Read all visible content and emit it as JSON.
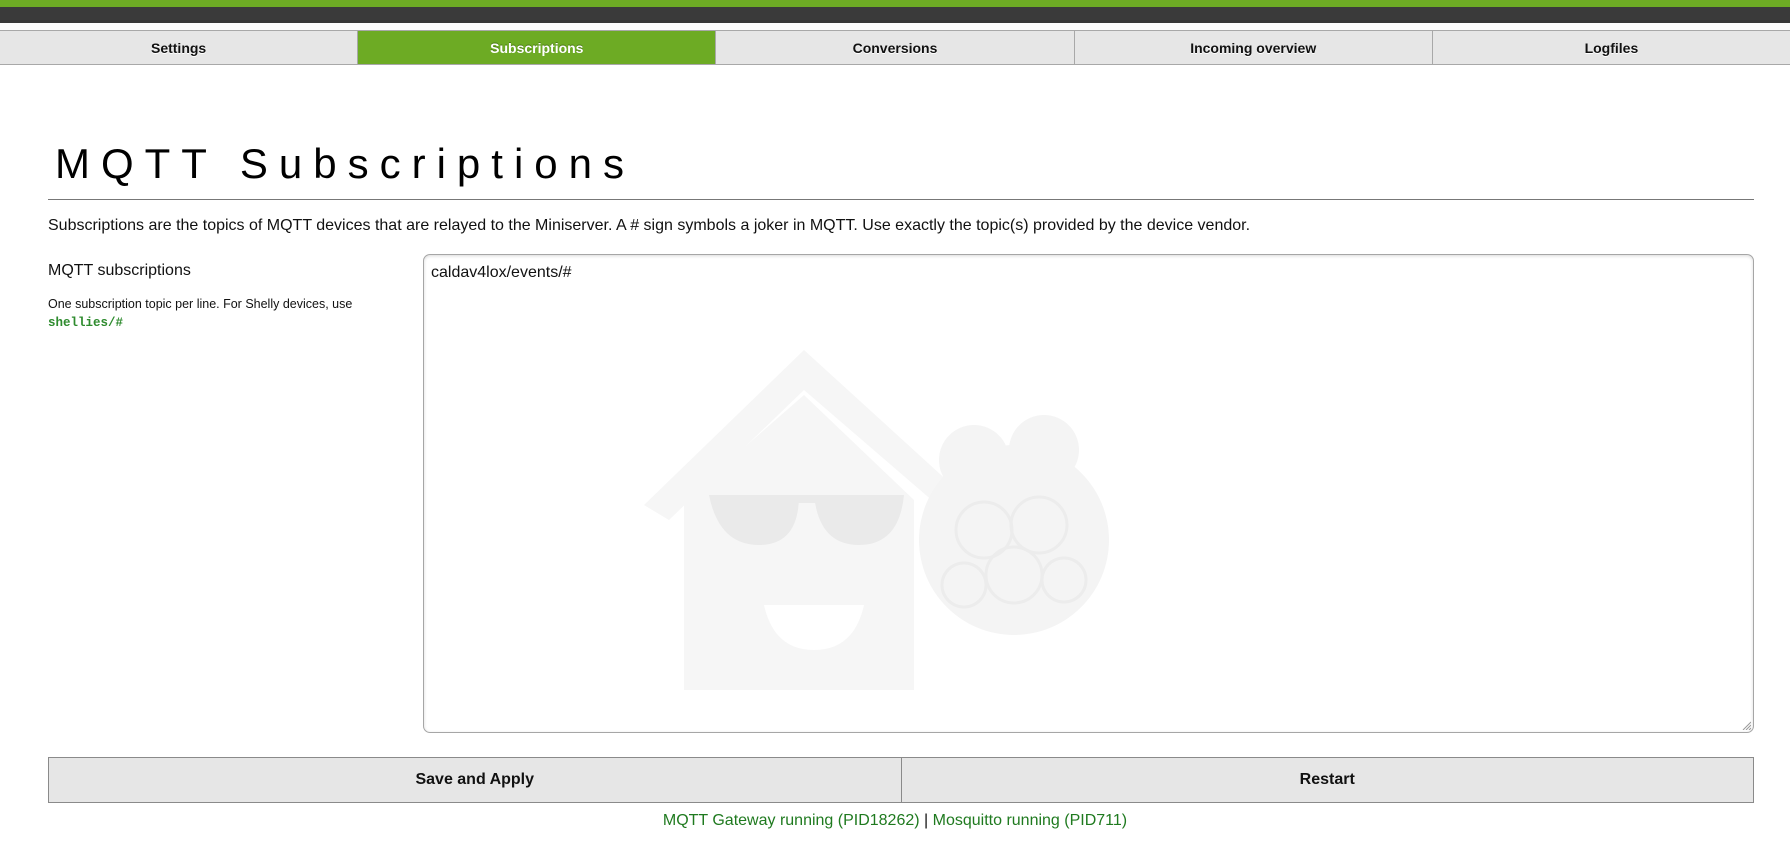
{
  "nav": {
    "tabs": [
      {
        "label": "Settings",
        "active": false
      },
      {
        "label": "Subscriptions",
        "active": true
      },
      {
        "label": "Conversions",
        "active": false
      },
      {
        "label": "Incoming overview",
        "active": false
      },
      {
        "label": "Logfiles",
        "active": false
      }
    ]
  },
  "page": {
    "title": "MQTT Subscriptions",
    "intro": "Subscriptions are the topics of MQTT devices that are relayed to the Miniserver. A # sign symbols a joker in MQTT. Use exactly the topic(s) provided by the device vendor."
  },
  "subscriptions": {
    "label": "MQTT subscriptions",
    "hint": "One subscription topic per line. For Shelly devices, use",
    "hint_code": "shellies/#",
    "value": "caldav4lox/events/#"
  },
  "buttons": {
    "save": "Save and Apply",
    "restart": "Restart"
  },
  "status": {
    "gateway": "MQTT Gateway running (PID18262)",
    "separator": "|",
    "mosquitto": "Mosquitto running (PID711)"
  },
  "colors": {
    "accent_green": "#6dab24",
    "status_green": "#1f7a1f",
    "code_green": "#2e8b2e",
    "header_dark": "#3a3a3a"
  }
}
